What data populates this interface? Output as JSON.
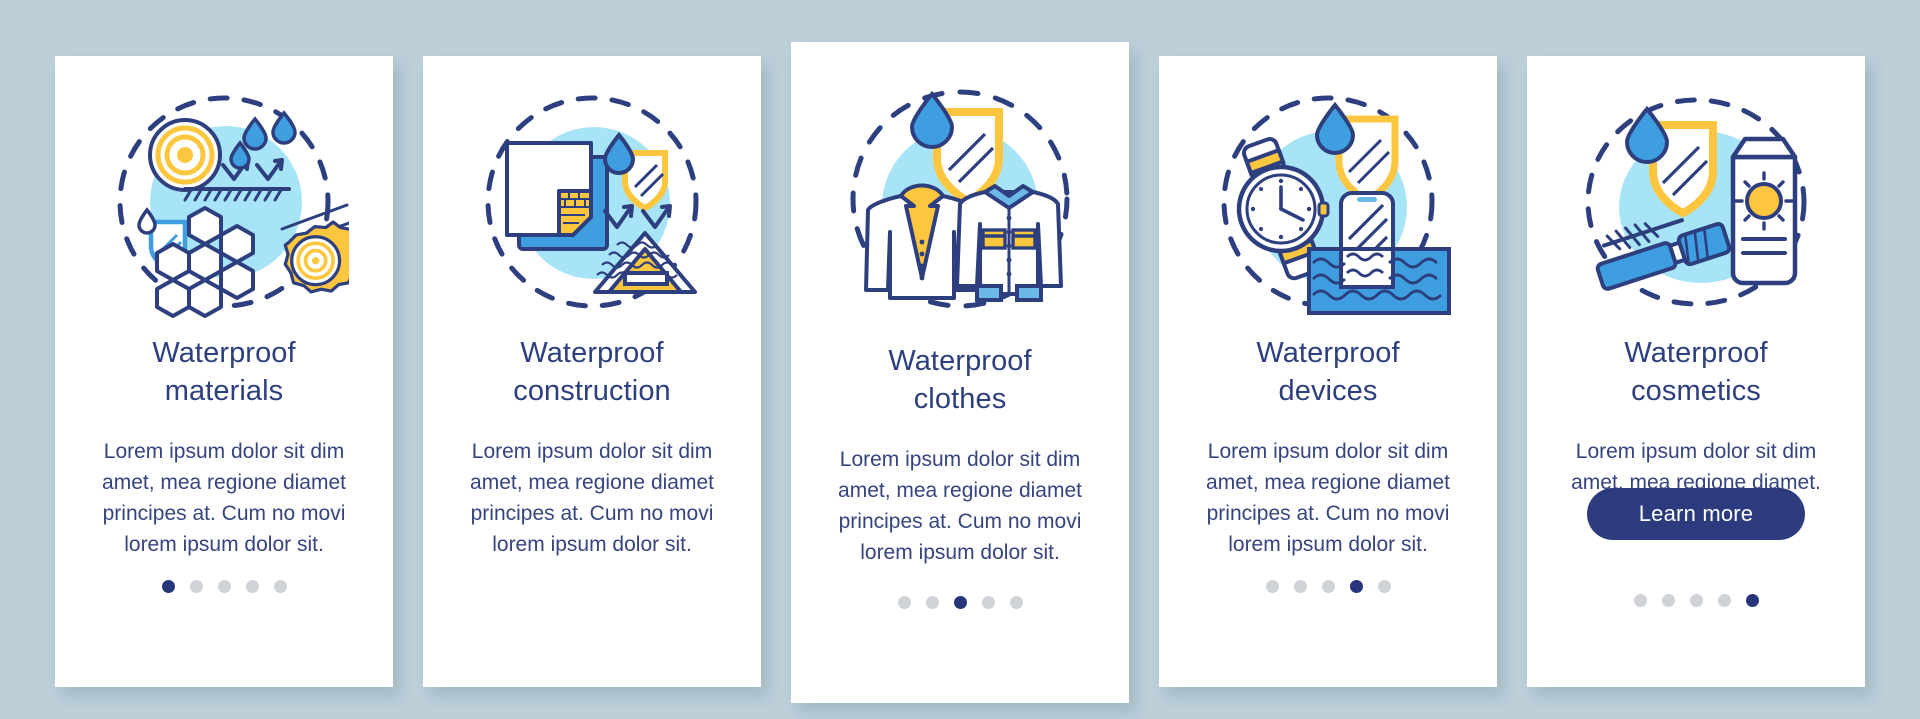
{
  "theme": {
    "background": "#bdd0da",
    "card_background": "#ffffff",
    "title_color": "#2d3f7e",
    "text_color": "#35447f",
    "accent_navy": "#2c3b7e",
    "accent_blue": "#3f9ee0",
    "accent_yellow": "#fcc63f",
    "accent_lightblue": "#a8e4f7",
    "dot_inactive": "#cfd2d6",
    "dot_active": "#27367a"
  },
  "cards": [
    {
      "icon_name": "waterproof-materials-illustration",
      "title": "Waterproof materials",
      "title_line1": "Waterproof",
      "title_line2": "materials",
      "description": "Lorem ipsum dolor sit dim amet, mea regione diamet principes at. Cum no movi lorem ipsum dolor sit.",
      "dots_total": 5,
      "dot_active_index": 0,
      "has_button": false,
      "button_label": ""
    },
    {
      "icon_name": "waterproof-construction-illustration",
      "title": "Waterproof construction",
      "title_line1": "Waterproof",
      "title_line2": "construction",
      "description": "Lorem ipsum dolor sit dim amet, mea regione diamet principes at. Cum no movi lorem ipsum dolor sit.",
      "dots_total": 0,
      "dot_active_index": -1,
      "has_button": false,
      "button_label": ""
    },
    {
      "icon_name": "waterproof-clothes-illustration",
      "title": "Waterproof clothes",
      "title_line1": "Waterproof",
      "title_line2": "clothes",
      "description": "Lorem ipsum dolor sit dim amet, mea regione diamet principes at. Cum no movi lorem ipsum dolor sit.",
      "dots_total": 5,
      "dot_active_index": 2,
      "has_button": false,
      "button_label": ""
    },
    {
      "icon_name": "waterproof-devices-illustration",
      "title": "Waterproof devices",
      "title_line1": "Waterproof",
      "title_line2": "devices",
      "description": "Lorem ipsum dolor sit dim amet, mea regione diamet principes at. Cum no movi lorem ipsum dolor sit.",
      "dots_total": 5,
      "dot_active_index": 3,
      "has_button": false,
      "button_label": ""
    },
    {
      "icon_name": "waterproof-cosmetics-illustration",
      "title": "Waterproof cosmetics",
      "title_line1": "Waterproof",
      "title_line2": "cosmetics",
      "description": "Lorem ipsum dolor sit dim amet, mea regione diamet.",
      "dots_total": 5,
      "dot_active_index": 4,
      "has_button": true,
      "button_label": "Learn more"
    }
  ]
}
